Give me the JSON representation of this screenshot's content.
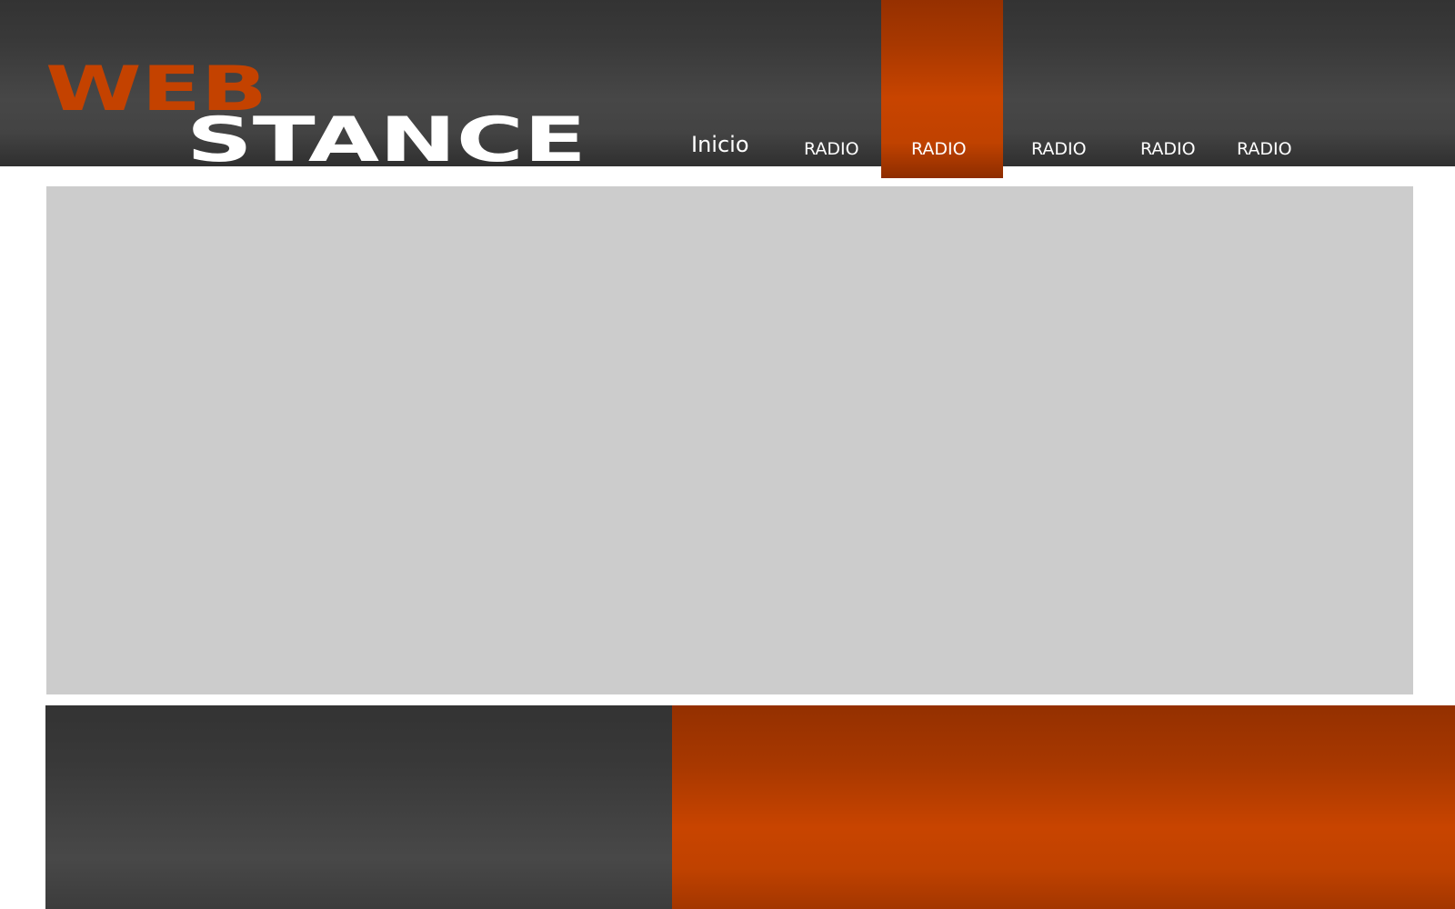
{
  "logo": {
    "line1": "WEB",
    "line2": "STANCE",
    "accent_color": "#c44200",
    "secondary_color": "#ffffff"
  },
  "nav": {
    "items": [
      {
        "label": "Inicio",
        "active": false
      },
      {
        "label": "RADIO",
        "active": false
      },
      {
        "label": "RADIO",
        "active": true
      },
      {
        "label": "RADIO",
        "active": false
      },
      {
        "label": "RADIO",
        "active": false
      },
      {
        "label": "RADIO",
        "active": false
      }
    ],
    "active_color": "#c44200"
  },
  "colors": {
    "header_dark": "#3a3a3a",
    "content_placeholder": "#cccccc",
    "accent_orange": "#c44200"
  }
}
